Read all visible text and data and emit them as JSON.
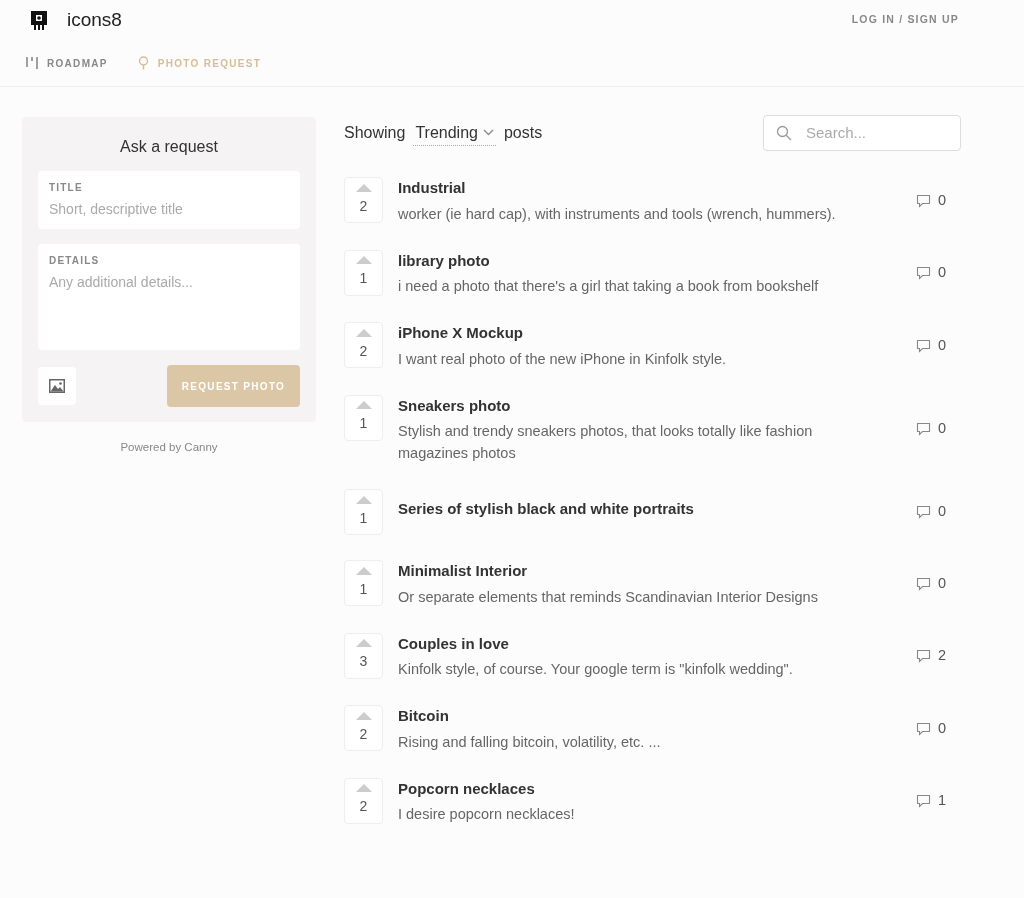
{
  "header": {
    "brand": "icons8",
    "login": "LOG IN / SIGN UP"
  },
  "tabs": [
    {
      "label": "ROADMAP",
      "kind": "roadmap",
      "selected": false
    },
    {
      "label": "PHOTO REQUEST",
      "kind": "request",
      "selected": true
    }
  ],
  "request_form": {
    "title": "Ask a request",
    "fields": [
      {
        "label": "TITLE",
        "placeholder": "Short, descriptive title",
        "kind": "line"
      },
      {
        "label": "DETAILS",
        "placeholder": "Any additional details...",
        "kind": "area"
      }
    ],
    "submit": "REQUEST PHOTO",
    "powered_by": "Powered by Canny"
  },
  "filter": {
    "prefix": "Showing",
    "sort": "Trending",
    "suffix": "posts"
  },
  "search": {
    "placeholder": "Search..."
  },
  "posts": [
    {
      "title": "Industrial",
      "details": "worker (ie hard cap), with instruments and tools (wrench, hummers).",
      "votes": "2",
      "comments": "0"
    },
    {
      "title": "library photo",
      "details": "i need a photo that there's a girl that taking a book from bookshelf",
      "votes": "1",
      "comments": "0"
    },
    {
      "title": "iPhone X Mockup",
      "details": "I want real photo of the new iPhone in Kinfolk style.",
      "votes": "2",
      "comments": "0"
    },
    {
      "title": "Sneakers photo",
      "details": "Stylish and trendy sneakers photos, that looks totally like fashion magazines photos",
      "votes": "1",
      "comments": "0"
    },
    {
      "title": "Series of stylish black and white portraits",
      "votes": "1",
      "comments": "0"
    },
    {
      "title": "Minimalist Interior",
      "details": "Or separate elements that reminds Scandinavian Interior Designs",
      "votes": "1",
      "comments": "0"
    },
    {
      "title": "Couples in love",
      "details": "Kinfolk style, of course. Your google term is \"kinfolk wedding\".",
      "votes": "3",
      "comments": "2"
    },
    {
      "title": "Bitcoin",
      "details": "Rising and falling bitcoin, volatility, etc. ...",
      "votes": "2",
      "comments": "0"
    },
    {
      "title": "Popcorn necklaces",
      "details": "I desire popcorn necklaces!",
      "votes": "2",
      "comments": "1"
    }
  ]
}
